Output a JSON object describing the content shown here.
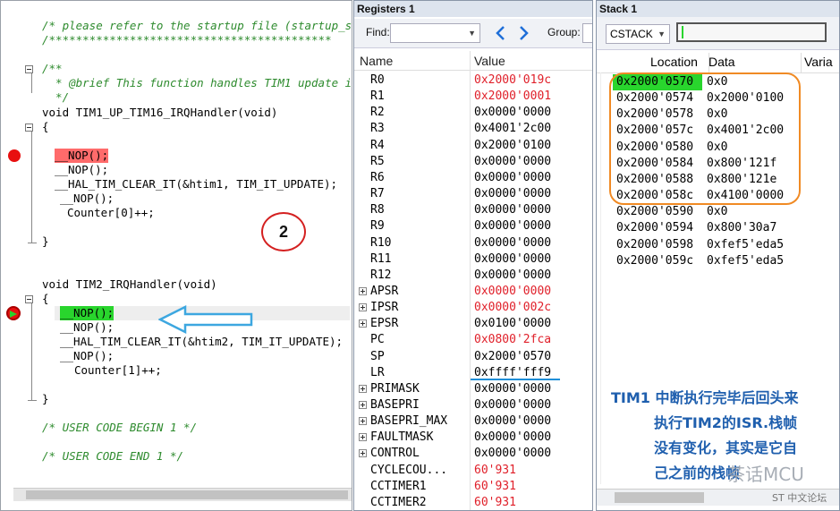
{
  "code": {
    "lines": [
      "/* please refer to the startup file (startup_s",
      "/******************************************",
      "/**",
      "  * @brief This function handles TIM1 update i",
      "  */",
      "void TIM1_UP_TIM16_IRQHandler(void)",
      "{",
      "__NOP();",
      "__NOP();",
      "__HAL_TIM_CLEAR_IT(&htim1, TIM_IT_UPDATE);",
      "__NOP();",
      "Counter[0]++;",
      "}",
      "void TIM2_IRQHandler(void)",
      "{",
      "__NOP();",
      "__NOP();",
      "__HAL_TIM_CLEAR_IT(&htim2, TIM_IT_UPDATE);",
      "__NOP();",
      "Counter[1]++;",
      "}",
      "/* USER CODE BEGIN 1 */",
      "/* USER CODE END 1 */"
    ],
    "annotation_number": "2"
  },
  "registers": {
    "title": "Registers 1",
    "find_label": "Find:",
    "group_label": "Group:",
    "col_name": "Name",
    "col_value": "Value",
    "rows": [
      {
        "name": "R0",
        "value": "0x2000'019c",
        "red": true
      },
      {
        "name": "R1",
        "value": "0x2000'0001",
        "red": true
      },
      {
        "name": "R2",
        "value": "0x0000'0000",
        "red": false
      },
      {
        "name": "R3",
        "value": "0x4001'2c00",
        "red": false
      },
      {
        "name": "R4",
        "value": "0x2000'0100",
        "red": false
      },
      {
        "name": "R5",
        "value": "0x0000'0000",
        "red": false
      },
      {
        "name": "R6",
        "value": "0x0000'0000",
        "red": false
      },
      {
        "name": "R7",
        "value": "0x0000'0000",
        "red": false
      },
      {
        "name": "R8",
        "value": "0x0000'0000",
        "red": false
      },
      {
        "name": "R9",
        "value": "0x0000'0000",
        "red": false
      },
      {
        "name": "R10",
        "value": "0x0000'0000",
        "red": false
      },
      {
        "name": "R11",
        "value": "0x0000'0000",
        "red": false
      },
      {
        "name": "R12",
        "value": "0x0000'0000",
        "red": false
      },
      {
        "name": "APSR",
        "value": "0x0000'0000",
        "red": true,
        "expand": true
      },
      {
        "name": "IPSR",
        "value": "0x0000'002c",
        "red": true,
        "expand": true
      },
      {
        "name": "EPSR",
        "value": "0x0100'0000",
        "red": false,
        "expand": true
      },
      {
        "name": "PC",
        "value": "0x0800'2fca",
        "red": true
      },
      {
        "name": "SP",
        "value": "0x2000'0570",
        "red": false
      },
      {
        "name": "LR",
        "value": "0xffff'fff9",
        "red": false
      },
      {
        "name": "PRIMASK",
        "value": "0x0000'0000",
        "red": false,
        "expand": true
      },
      {
        "name": "BASEPRI",
        "value": "0x0000'0000",
        "red": false,
        "expand": true
      },
      {
        "name": "BASEPRI_MAX",
        "value": "0x0000'0000",
        "red": false,
        "expand": true
      },
      {
        "name": "FAULTMASK",
        "value": "0x0000'0000",
        "red": false,
        "expand": true
      },
      {
        "name": "CONTROL",
        "value": "0x0000'0000",
        "red": false,
        "expand": true
      },
      {
        "name": "CYCLECOU...",
        "value": "60'931",
        "red": true
      },
      {
        "name": "CCTIMER1",
        "value": "60'931",
        "red": true
      },
      {
        "name": "CCTIMER2",
        "value": "60'931",
        "red": true
      }
    ]
  },
  "stack": {
    "title": "Stack 1",
    "select_value": "CSTACK",
    "col_location": "Location",
    "col_data": "Data",
    "col_variable": "Varia",
    "rows": [
      {
        "loc": "0x2000'0570",
        "data": "0x0"
      },
      {
        "loc": "0x2000'0574",
        "data": "0x2000'0100"
      },
      {
        "loc": "0x2000'0578",
        "data": "0x0"
      },
      {
        "loc": "0x2000'057c",
        "data": "0x4001'2c00"
      },
      {
        "loc": "0x2000'0580",
        "data": "0x0"
      },
      {
        "loc": "0x2000'0584",
        "data": "0x800'121f"
      },
      {
        "loc": "0x2000'0588",
        "data": "0x800'121e"
      },
      {
        "loc": "0x2000'058c",
        "data": "0x4100'0000"
      },
      {
        "loc": "0x2000'0590",
        "data": "0x0"
      },
      {
        "loc": "0x2000'0594",
        "data": "0x800'30a7"
      },
      {
        "loc": "0x2000'0598",
        "data": "0xfef5'eda5"
      },
      {
        "loc": "0x2000'059c",
        "data": "0xfef5'eda5"
      }
    ],
    "note_lines": [
      "TIM1 中断执行完毕后回头来",
      "执行TIM2的ISR.栈帧",
      "没有变化，其实是它自",
      "己之前的栈帧"
    ],
    "watermark": "茶话MCU",
    "footer": "ST 中文论坛"
  },
  "colors": {
    "highlight_green": "#29d52d",
    "breakpoint_red": "#ff6b6b",
    "annotation_orange": "#f08a24",
    "arrow_blue": "#3da7e0",
    "note_blue": "#1f5fae"
  }
}
